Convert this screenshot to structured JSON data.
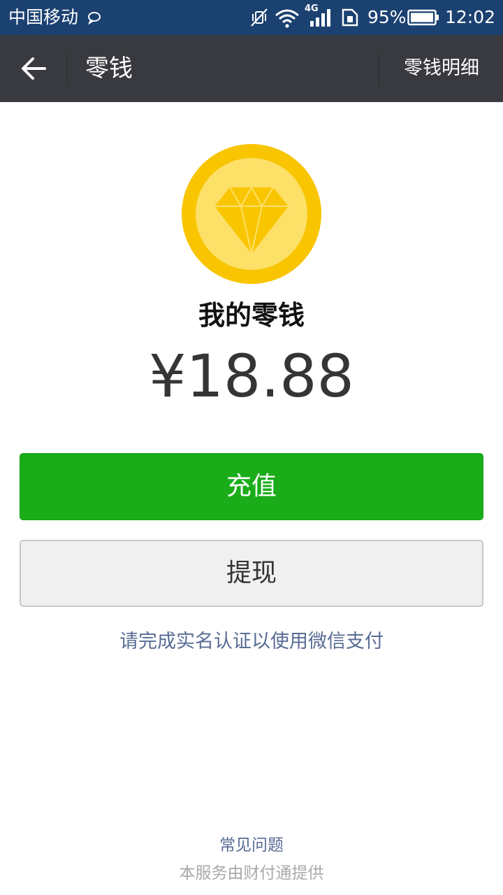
{
  "status_bar": {
    "carrier": "中国移动",
    "network_label": "4G",
    "battery_percent": "95%",
    "time": "12:02",
    "icons": [
      "message-icon",
      "vibrate-off-icon",
      "wifi-icon",
      "signal-icon",
      "sim-icon",
      "battery-icon"
    ]
  },
  "title_bar": {
    "back_icon": "back-arrow-icon",
    "title": "零钱",
    "detail_label": "零钱明细"
  },
  "wallet": {
    "icon": "diamond-coin-icon",
    "label": "我的零钱",
    "balance": "¥18.88"
  },
  "actions": {
    "recharge_label": "充值",
    "withdraw_label": "提现"
  },
  "notice": {
    "verify_text": "请完成实名认证以使用微信支付"
  },
  "footer": {
    "faq_label": "常见问题",
    "provider_text": "本服务由财付通提供"
  },
  "colors": {
    "status_bar_bg": "#1b4171",
    "title_bar_bg": "#393a3f",
    "primary_green": "#1aad19",
    "link_blue": "#586c94",
    "coin_outer": "#f8c500",
    "coin_inner": "#fde068"
  }
}
